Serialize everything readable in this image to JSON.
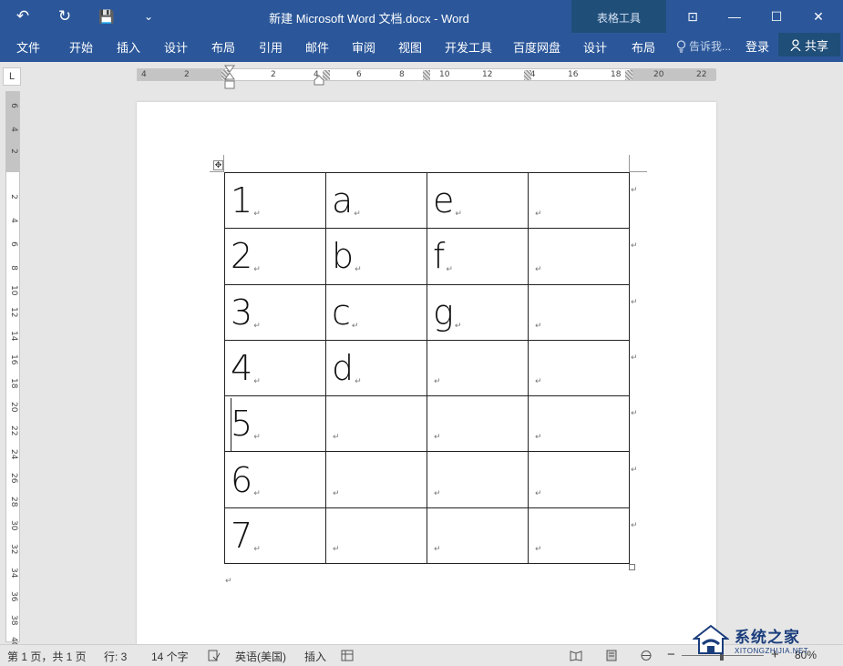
{
  "window": {
    "title": "新建 Microsoft Word 文档.docx - Word",
    "contextual_group": "表格工具",
    "qa_undo": "↶",
    "qa_redo": "↻",
    "qa_save": "💾",
    "qa_more": "⌄"
  },
  "window_controls": {
    "ribbon_display": "⊡",
    "minimize": "—",
    "maximize": "☐",
    "close": "✕"
  },
  "ribbon": {
    "tabs": [
      "文件",
      "开始",
      "插入",
      "设计",
      "布局",
      "引用",
      "邮件",
      "审阅",
      "视图",
      "开发工具",
      "百度网盘",
      "设计",
      "布局"
    ],
    "tell_me": "告诉我...",
    "login": "登录",
    "share": "共享"
  },
  "ruler": {
    "corner": "L",
    "h_numbers": [
      "4",
      "2",
      "2",
      "4",
      "6",
      "8",
      "10",
      "12",
      "14",
      "16",
      "18",
      "20",
      "22"
    ],
    "v_numbers": [
      "6",
      "4",
      "2",
      "2",
      "4",
      "6",
      "8",
      "10",
      "12",
      "14",
      "16",
      "18",
      "20",
      "22",
      "24",
      "26",
      "28",
      "30",
      "32",
      "34",
      "36",
      "38",
      "40"
    ]
  },
  "table": {
    "rows": [
      [
        "1",
        "a",
        "e",
        ""
      ],
      [
        "2",
        "b",
        "f",
        ""
      ],
      [
        "3",
        "c",
        "g",
        ""
      ],
      [
        "4",
        "d",
        "",
        ""
      ],
      [
        "5",
        "",
        "",
        ""
      ],
      [
        "6",
        "",
        "",
        ""
      ],
      [
        "7",
        "",
        "",
        ""
      ]
    ],
    "paragraph_mark": "↵",
    "move_handle": "✥"
  },
  "statusbar": {
    "page": "第 1 页，共 1 页",
    "words": "行: 3",
    "chars": "14 个字",
    "language": "英语(美国)",
    "mode": "插入",
    "zoom": "80%",
    "zoom_minus": "−",
    "zoom_plus": "+"
  },
  "watermark": {
    "main": "系统之家",
    "sub": "XITONGZHIJIA.NET"
  }
}
